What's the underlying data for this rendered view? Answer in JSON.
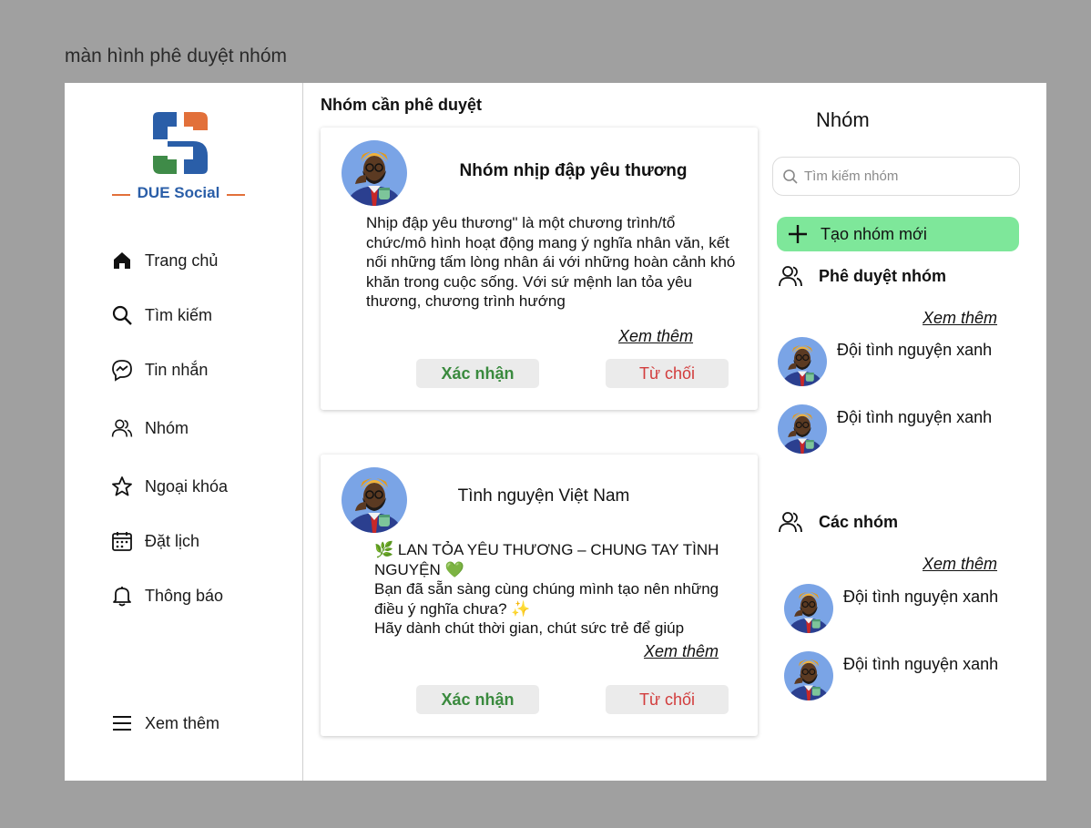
{
  "frame_label": "màn hình phê duyệt nhóm",
  "brand": {
    "name": "DUE Social",
    "colors": {
      "orange": "#e2703a",
      "blue": "#2a5ea8",
      "green": "#3f8b48"
    }
  },
  "nav": {
    "items": [
      {
        "label": "Trang chủ",
        "icon": "home-icon"
      },
      {
        "label": "Tìm kiếm",
        "icon": "search-icon"
      },
      {
        "label": "Tin nhắn",
        "icon": "messenger-icon"
      },
      {
        "label": "Nhóm",
        "icon": "group-icon"
      },
      {
        "label": "Ngoại khóa",
        "icon": "star-icon"
      },
      {
        "label": "Đặt lịch",
        "icon": "calendar-icon"
      },
      {
        "label": "Thông báo",
        "icon": "bell-icon"
      }
    ],
    "more": {
      "label": "Xem thêm",
      "icon": "menu-icon"
    }
  },
  "main": {
    "title": "Nhóm cần phê duyệt",
    "cards": [
      {
        "name": "Nhóm nhịp đập yêu thương",
        "description": "Nhịp đập yêu thương\" là một chương trình/tổ chức/mô hình hoạt động mang ý nghĩa nhân văn, kết nối những tấm lòng nhân ái với những hoàn cảnh khó khăn trong cuộc sống. Với sứ mệnh lan tỏa yêu thương, chương trình hướng",
        "more": "Xem thêm",
        "confirm": "Xác nhận",
        "reject": "Từ chối"
      },
      {
        "name": "Tình nguyện Việt Nam",
        "description": "🌿 LAN TỎA YÊU THƯƠNG – CHUNG TAY TÌNH NGUYỆN 💚\nBạn đã sẵn sàng cùng chúng mình tạo nên những điều ý nghĩa chưa? ✨\n Hãy dành chút thời gian, chút sức trẻ để giúp",
        "more": "Xem thêm",
        "confirm": "Xác nhận",
        "reject": "Từ chối"
      }
    ]
  },
  "right": {
    "title": "Nhóm",
    "search_placeholder": "Tìm kiếm nhóm",
    "create_label": "Tạo nhóm mới",
    "approval": {
      "title": "Phê duyệt nhóm",
      "more": "Xem thêm",
      "groups": [
        "Đội tình nguyện xanh",
        "Đội tình nguyện xanh"
      ]
    },
    "all_groups": {
      "title": "Các nhóm",
      "more": "Xem thêm",
      "groups": [
        "Đội tình nguyện xanh",
        "Đội tình nguyện xanh"
      ]
    }
  }
}
